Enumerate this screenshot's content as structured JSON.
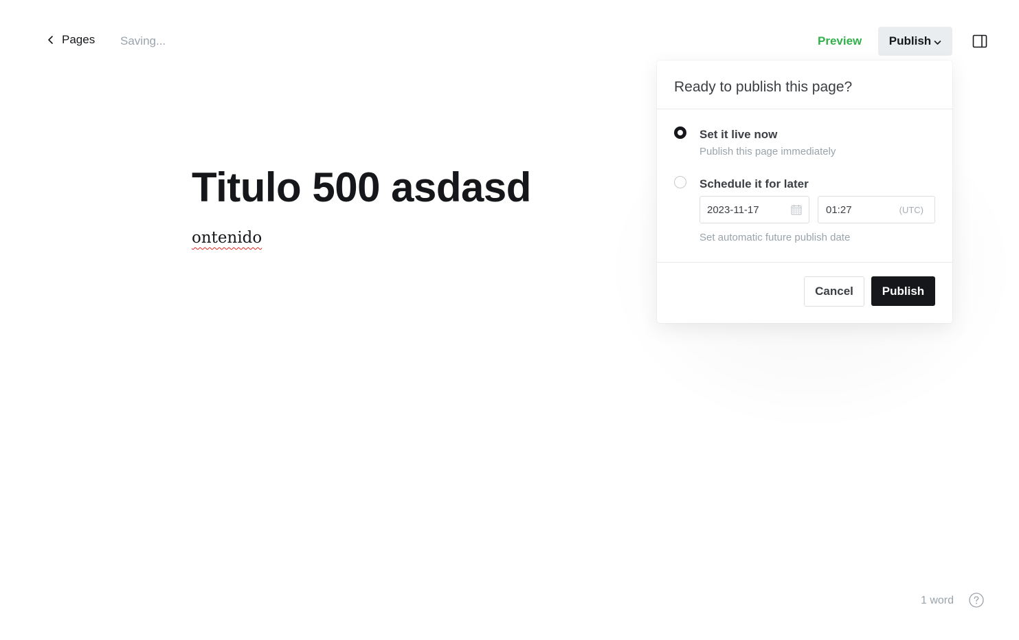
{
  "topbar": {
    "back_label": "Pages",
    "status": "Saving...",
    "preview_label": "Preview",
    "publish_menu_label": "Publish"
  },
  "editor": {
    "title": "Titulo 500 asdasd",
    "body": "ontenido"
  },
  "publish_popover": {
    "heading": "Ready to publish this page?",
    "options": [
      {
        "label": "Set it live now",
        "description": "Publish this page immediately",
        "selected": true
      },
      {
        "label": "Schedule it for later",
        "selected": false
      }
    ],
    "schedule": {
      "date": "2023-11-17",
      "time": "01:27",
      "timezone": "(UTC)",
      "hint": "Set automatic future publish date"
    },
    "cancel_label": "Cancel",
    "confirm_label": "Publish"
  },
  "footer": {
    "word_count": "1 word"
  },
  "icons": {
    "back": "chevron-left-icon",
    "publish_caret": "chevron-down-icon",
    "sidebar": "sidebar-panel-icon",
    "calendar": "calendar-icon",
    "help": "help-icon"
  },
  "colors": {
    "accent_green": "#30b14a",
    "primary_dark": "#15171a",
    "muted_text": "#9aa3ab",
    "button_grey": "#eaedf0"
  }
}
